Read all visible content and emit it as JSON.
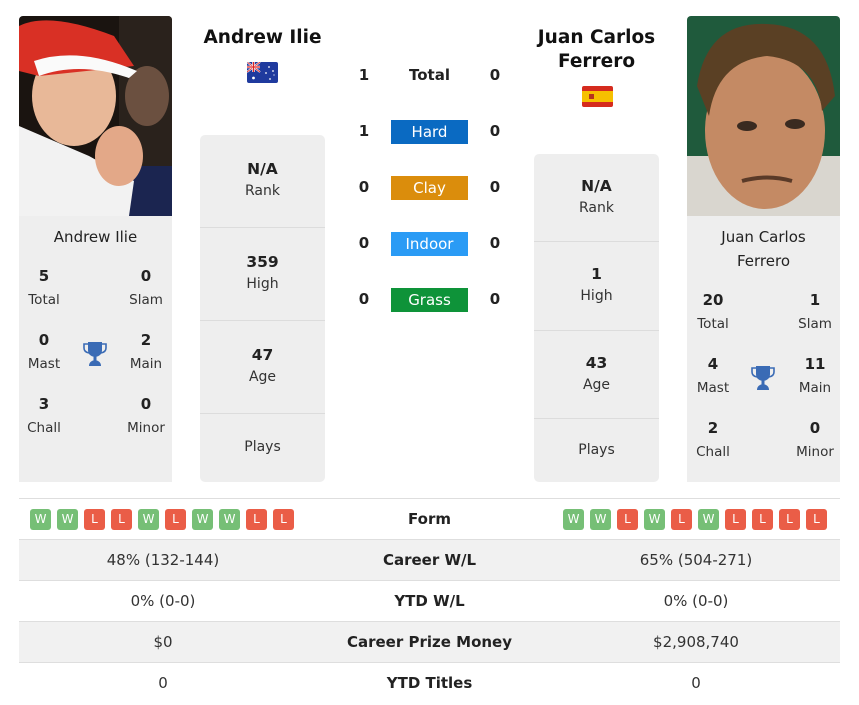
{
  "players": {
    "left": {
      "name": "Andrew Ilie",
      "card_name": "Andrew Ilie",
      "country": "Australia",
      "flag_icon": "australia-flag-icon",
      "titles": {
        "total": {
          "value": "5",
          "label": "Total"
        },
        "slam": {
          "value": "0",
          "label": "Slam"
        },
        "mast": {
          "value": "0",
          "label": "Mast"
        },
        "main": {
          "value": "2",
          "label": "Main"
        },
        "chall": {
          "value": "3",
          "label": "Chall"
        },
        "minor": {
          "value": "0",
          "label": "Minor"
        }
      },
      "stats": {
        "rank": {
          "value": "N/A",
          "label": "Rank"
        },
        "high": {
          "value": "359",
          "label": "High"
        },
        "age": {
          "value": "47",
          "label": "Age"
        },
        "plays": {
          "value": "",
          "label": "Plays"
        }
      },
      "form": [
        "W",
        "W",
        "L",
        "L",
        "W",
        "L",
        "W",
        "W",
        "L",
        "L"
      ],
      "career_wl": "48% (132-144)",
      "ytd_wl": "0% (0-0)",
      "career_prize_money": "$0",
      "ytd_titles": "0"
    },
    "right": {
      "name": "Juan Carlos Ferrero",
      "card_name_line1": "Juan Carlos",
      "card_name_line2": "Ferrero",
      "country": "Spain",
      "flag_icon": "spain-flag-icon",
      "titles": {
        "total": {
          "value": "20",
          "label": "Total"
        },
        "slam": {
          "value": "1",
          "label": "Slam"
        },
        "mast": {
          "value": "4",
          "label": "Mast"
        },
        "main": {
          "value": "11",
          "label": "Main"
        },
        "chall": {
          "value": "2",
          "label": "Chall"
        },
        "minor": {
          "value": "0",
          "label": "Minor"
        }
      },
      "stats": {
        "rank": {
          "value": "N/A",
          "label": "Rank"
        },
        "high": {
          "value": "1",
          "label": "High"
        },
        "age": {
          "value": "43",
          "label": "Age"
        },
        "plays": {
          "value": "",
          "label": "Plays"
        }
      },
      "form": [
        "W",
        "W",
        "L",
        "W",
        "L",
        "W",
        "L",
        "L",
        "L",
        "L"
      ],
      "career_wl": "65% (504-271)",
      "ytd_wl": "0% (0-0)",
      "career_prize_money": "$2,908,740",
      "ytd_titles": "0"
    }
  },
  "h2h": {
    "total": {
      "label": "Total",
      "left": "1",
      "right": "0"
    },
    "surfaces": [
      {
        "label": "Hard",
        "left": "1",
        "right": "0",
        "color": "#0a6ac2"
      },
      {
        "label": "Clay",
        "left": "0",
        "right": "0",
        "color": "#db8d0c"
      },
      {
        "label": "Indoor",
        "left": "0",
        "right": "0",
        "color": "#2a9bf5"
      },
      {
        "label": "Grass",
        "left": "0",
        "right": "0",
        "color": "#0e9339"
      }
    ]
  },
  "table": {
    "form_label": "Form",
    "career_wl_label": "Career W/L",
    "ytd_wl_label": "YTD W/L",
    "prize_label": "Career Prize Money",
    "ytd_titles_label": "YTD Titles"
  },
  "colors": {
    "win": "#76bf76",
    "loss": "#ea5d47",
    "trophy": "#3a6bb5",
    "card_bg": "#eeeeee"
  }
}
